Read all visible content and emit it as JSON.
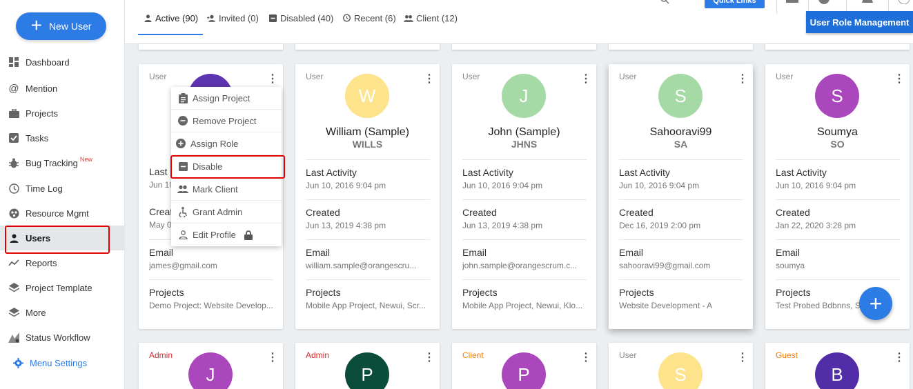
{
  "sidebar": {
    "new_user_label": "New User",
    "items": [
      {
        "label": "Dashboard",
        "icon": "dashboard-icon"
      },
      {
        "label": "Mention",
        "icon": "at-icon"
      },
      {
        "label": "Projects",
        "icon": "briefcase-icon"
      },
      {
        "label": "Tasks",
        "icon": "checkbox-icon"
      },
      {
        "label": "Bug Tracking",
        "icon": "bug-icon",
        "badge": "New"
      },
      {
        "label": "Time Log",
        "icon": "clock-icon"
      },
      {
        "label": "Resource Mgmt",
        "icon": "resource-icon"
      },
      {
        "label": "Users",
        "icon": "person-icon"
      },
      {
        "label": "Reports",
        "icon": "chart-line-icon"
      },
      {
        "label": "Project Template",
        "icon": "layers-icon"
      },
      {
        "label": "More",
        "icon": "layers-icon"
      },
      {
        "label": "Status Workflow",
        "icon": "workflow-icon"
      },
      {
        "label": "Menu Settings",
        "icon": "gear-icon"
      }
    ]
  },
  "tabs": [
    {
      "label": "Active (90)"
    },
    {
      "label": "Invited (0)"
    },
    {
      "label": "Disabled (40)"
    },
    {
      "label": "Recent (6)"
    },
    {
      "label": "Client (12)"
    }
  ],
  "header": {
    "quick_links_label": "Quick Links",
    "user_role_management_label": "User Role Management"
  },
  "menu": {
    "items": [
      {
        "label": "Assign Project",
        "icon": "clipboard-icon"
      },
      {
        "label": "Remove Project",
        "icon": "minus-circle-icon"
      },
      {
        "label": "Assign Role",
        "icon": "plus-circle-icon"
      },
      {
        "label": "Disable",
        "icon": "minus-square-icon"
      },
      {
        "label": "Mark Client",
        "icon": "people-icon"
      },
      {
        "label": "Grant Admin",
        "icon": "accessibility-icon"
      },
      {
        "label": "Edit Profile",
        "icon": "person-outline-icon"
      }
    ]
  },
  "labels": {
    "last_activity": "Last Activity",
    "created": "Created",
    "email": "Email",
    "projects": "Projects"
  },
  "cards": [
    {
      "role": "User",
      "avatar_letter": "",
      "avatar_color": "#5e35b1",
      "name": "",
      "short": "",
      "last_activity_label": "Last",
      "last_activity": "Jun 10",
      "created_label": "Creat",
      "created": "May 0",
      "email": "james@gmail.com",
      "projects": "Demo Project: Website Develop..."
    },
    {
      "role": "User",
      "avatar_letter": "W",
      "avatar_color": "#fde38b",
      "name": "William (Sample)",
      "short": "WILLS",
      "last_activity": "Jun 10, 2016 9:04 pm",
      "created": "Jun 13, 2019 4:38 pm",
      "email": "william.sample@orangescru...",
      "projects": "Mobile App Project, Newui, Scr..."
    },
    {
      "role": "User",
      "avatar_letter": "J",
      "avatar_color": "#a5d9a5",
      "name": "John (Sample)",
      "short": "JHNS",
      "last_activity": "Jun 10, 2016 9:04 pm",
      "created": "Jun 13, 2019 4:38 pm",
      "email": "john.sample@orangescrum.c...",
      "projects": "Mobile App Project, Newui, Klo..."
    },
    {
      "role": "User",
      "avatar_letter": "S",
      "avatar_color": "#a5d9a5",
      "name": "Sahooravi99",
      "short": "SA",
      "last_activity": "Jun 10, 2016 9:04 pm",
      "created": "Dec 16, 2019 2:00 pm",
      "email": "sahooravi99@gmail.com",
      "projects": "Website Development - A"
    },
    {
      "role": "User",
      "avatar_letter": "S",
      "avatar_color": "#ab47bc",
      "name": "Soumya",
      "short": "SO",
      "last_activity": "Jun 10, 2016 9:04 pm",
      "created": "Jan 22, 2020 3:28 pm",
      "email": "soumya",
      "projects": "Test Probed Bdbnns, S..."
    }
  ],
  "cards_row2": [
    {
      "role": "Admin",
      "avatar_letter": "J",
      "avatar_color": "#ab47bc"
    },
    {
      "role": "Admin",
      "avatar_letter": "P",
      "avatar_color": "#0b4d3a"
    },
    {
      "role": "Client",
      "avatar_letter": "P",
      "avatar_color": "#ab47bc"
    },
    {
      "role": "User",
      "avatar_letter": "S",
      "avatar_color": "#fde38b"
    },
    {
      "role": "Guest",
      "avatar_letter": "B",
      "avatar_color": "#512da8"
    }
  ],
  "colors": {
    "accent": "#2d7be5",
    "highlight": "#e00000"
  }
}
